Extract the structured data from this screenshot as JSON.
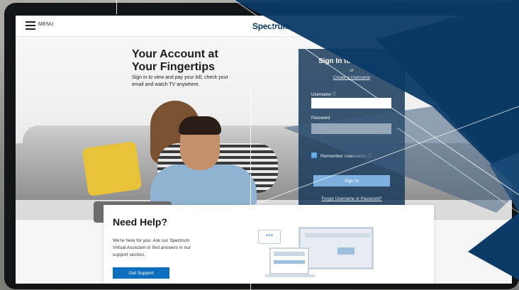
{
  "header": {
    "menu_label": "MENU",
    "logo_text": "Spectrum"
  },
  "hero": {
    "title_line1": "Your Account at",
    "title_line2": "Your Fingertips",
    "subtitle": "Sign in to view and pay your bill, check your email and watch TV anywhere."
  },
  "signin": {
    "title": "Sign In to",
    "or_text": "or",
    "create_link": "Create a Username",
    "username_label": "Username ⓘ",
    "password_label": "Password",
    "remember_label": "Remember Username ⓘ",
    "remember_checked": true,
    "submit_label": "Sign In",
    "forgot_link": "Forgot Username or Password?"
  },
  "help": {
    "title": "Need Help?",
    "text": "We're here for you. Ask our Spectrum Virtual Assistant or find answers in our support section.",
    "button_label": "Get Support",
    "chat_icon": "•••"
  },
  "colors": {
    "brand_navy": "#0a3a5e",
    "overlay_blue": "#0b3a66",
    "panel_blue": "#183a5c",
    "button_blue": "#0e6fbf"
  }
}
